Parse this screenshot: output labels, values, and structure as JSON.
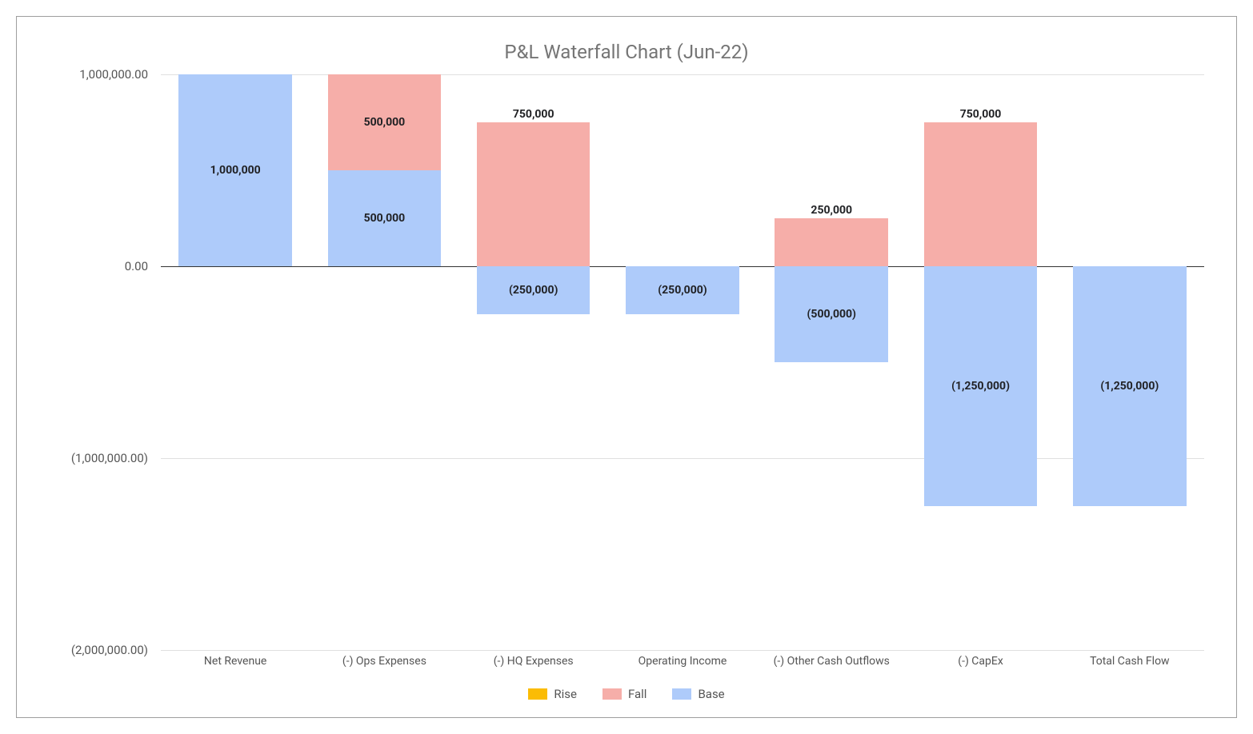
{
  "chart_data": {
    "type": "bar",
    "title": "P&L Waterfall Chart (Jun-22)",
    "categories": [
      "Net Revenue",
      "(-) Ops Expenses",
      "(-) HQ Expenses",
      "Operating Income",
      "(-) Other Cash Outflows",
      "(-) CapEx",
      "Total Cash Flow"
    ],
    "y_ticks": [
      {
        "value": 1000000,
        "label": "1,000,000.00"
      },
      {
        "value": 0,
        "label": "0.00"
      },
      {
        "value": -1000000,
        "label": "(1,000,000.00)"
      },
      {
        "value": -2000000,
        "label": "(2,000,000.00)"
      }
    ],
    "ylim": [
      -2000000,
      1000000
    ],
    "series": [
      {
        "name": "Base",
        "color": "#aecbfa",
        "values": [
          {
            "from": 0,
            "to": 1000000,
            "label": "1,000,000",
            "labelPos": "center"
          },
          {
            "from": 0,
            "to": 500000,
            "label": "500,000",
            "labelPos": "center"
          },
          {
            "from": 0,
            "to": -250000,
            "label": "(250,000)",
            "labelPos": "center"
          },
          {
            "from": 0,
            "to": -250000,
            "label": "(250,000)",
            "labelPos": "center"
          },
          {
            "from": 0,
            "to": -500000,
            "label": "(500,000)",
            "labelPos": "center"
          },
          {
            "from": 0,
            "to": -1250000,
            "label": "(1,250,000)",
            "labelPos": "center"
          },
          {
            "from": 0,
            "to": -1250000,
            "label": "(1,250,000)",
            "labelPos": "center"
          }
        ]
      },
      {
        "name": "Fall",
        "color": "#f6aea9",
        "values": [
          null,
          {
            "from": 500000,
            "to": 1000000,
            "label": "500,000",
            "labelPos": "center"
          },
          {
            "from": 0,
            "to": 750000,
            "label": "750,000",
            "labelPos": "above"
          },
          null,
          {
            "from": 0,
            "to": 250000,
            "label": "250,000",
            "labelPos": "above"
          },
          {
            "from": 0,
            "to": 750000,
            "label": "750,000",
            "labelPos": "above"
          },
          null
        ]
      },
      {
        "name": "Rise",
        "color": "#fbbc04",
        "values": [
          null,
          null,
          null,
          null,
          null,
          null,
          null
        ]
      }
    ],
    "legend": [
      {
        "name": "Rise",
        "color": "#fbbc04"
      },
      {
        "name": "Fall",
        "color": "#f6aea9"
      },
      {
        "name": "Base",
        "color": "#aecbfa"
      }
    ]
  }
}
